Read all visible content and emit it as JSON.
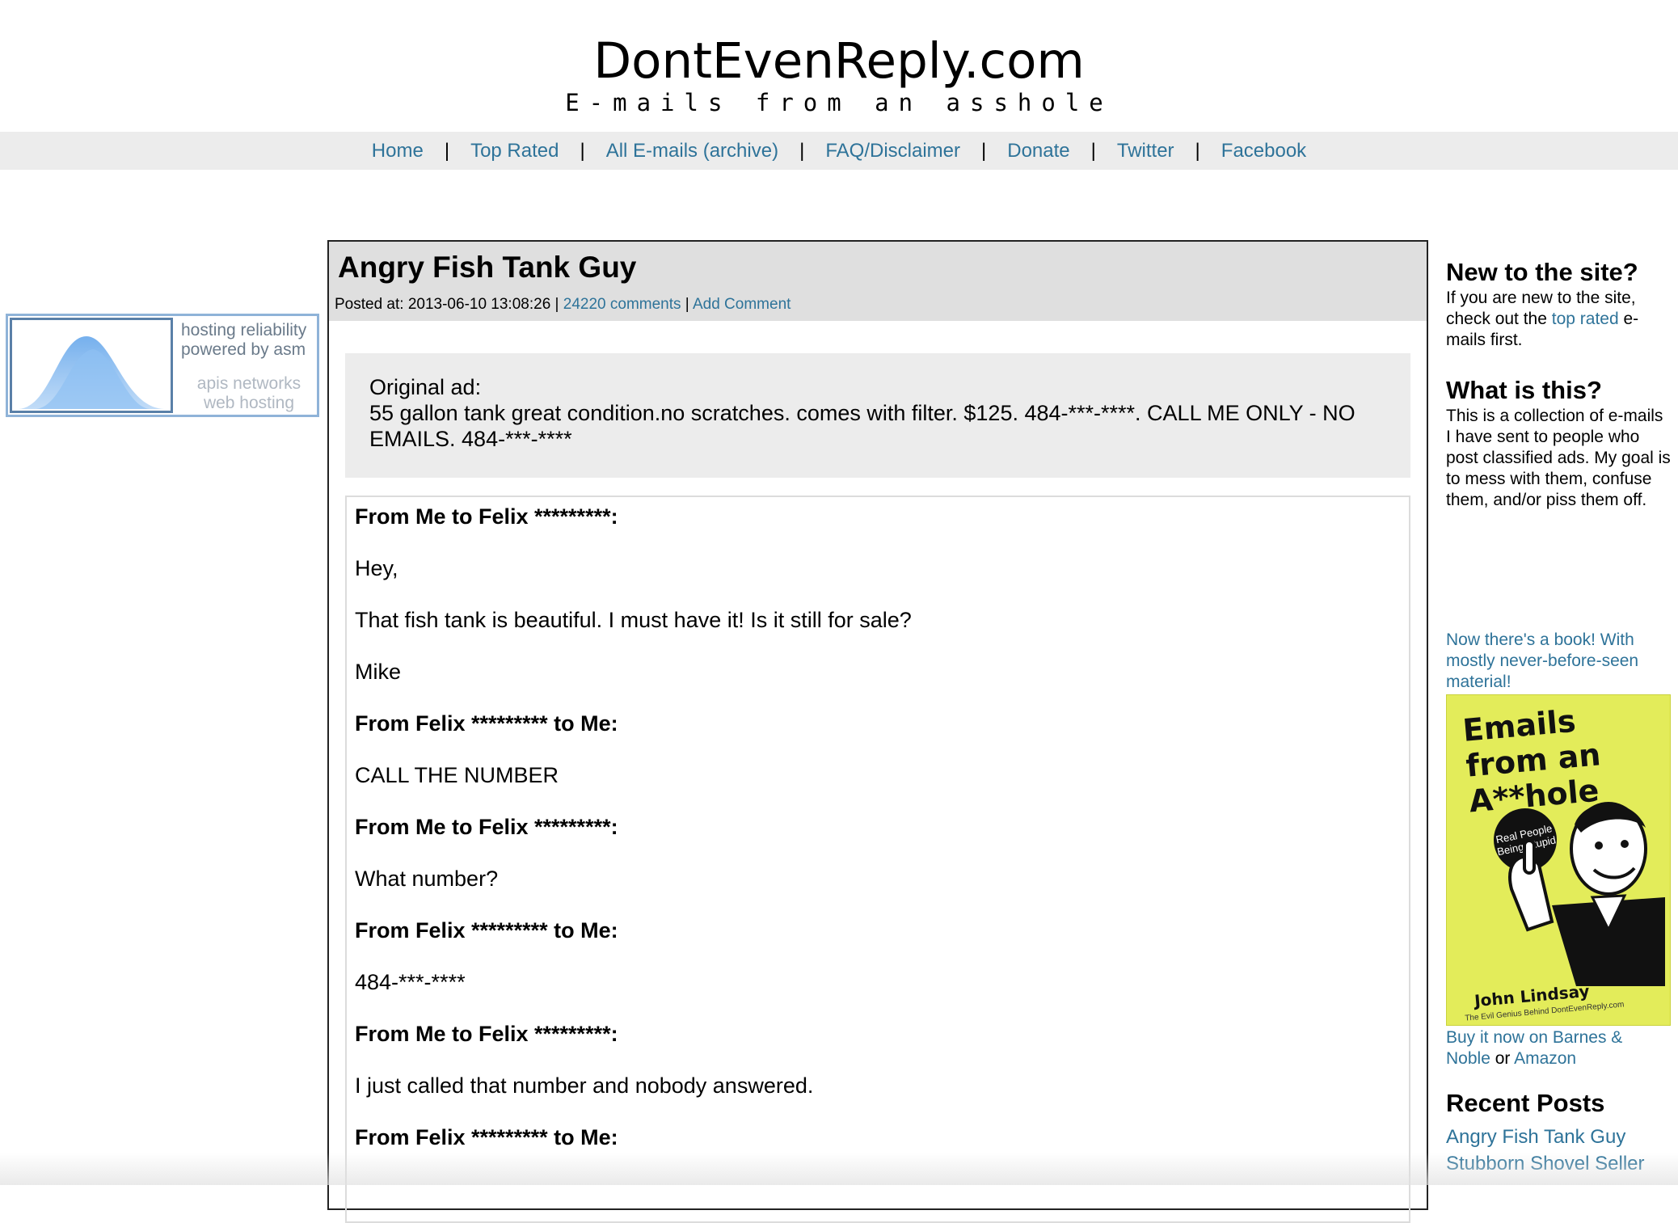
{
  "site": {
    "title": "DontEvenReply.com",
    "tagline": "E-mails from an asshole"
  },
  "nav": {
    "items": [
      "Home",
      "Top Rated",
      "All E-mails (archive)",
      "FAQ/Disclaimer",
      "Donate",
      "Twitter",
      "Facebook"
    ],
    "separator": "|"
  },
  "ad": {
    "line1": "hosting reliability",
    "line2": "powered by asm",
    "line3": "apis networks",
    "line4": "web hosting"
  },
  "post": {
    "title": "Angry Fish Tank Guy",
    "posted_label": "Posted at: 2013-06-10 13:08:26 |",
    "comments_link": "24220 comments",
    "meta_sep": "|",
    "add_comment_link": "Add Comment",
    "original_ad_label": "Original ad:",
    "original_ad_text": "55 gallon tank great condition.no scratches. comes with filter. $125. 484-***-****. CALL ME ONLY - NO EMAILS. 484-***-****",
    "emails": [
      {
        "type": "header",
        "text": "From Me to Felix *********:"
      },
      {
        "type": "body",
        "text": "Hey,"
      },
      {
        "type": "body",
        "text": "That fish tank is beautiful. I must have it! Is it still for sale?"
      },
      {
        "type": "body",
        "text": "Mike"
      },
      {
        "type": "header",
        "text": "From Felix ********* to Me:"
      },
      {
        "type": "body",
        "text": "CALL THE NUMBER"
      },
      {
        "type": "header",
        "text": "From Me to Felix *********:"
      },
      {
        "type": "body",
        "text": "What number?"
      },
      {
        "type": "header",
        "text": "From Felix ********* to Me:"
      },
      {
        "type": "body",
        "text": "484-***-****"
      },
      {
        "type": "header",
        "text": "From Me to Felix *********:"
      },
      {
        "type": "body",
        "text": "I just called that number and nobody answered."
      },
      {
        "type": "header",
        "text": "From Felix ********* to Me:"
      }
    ]
  },
  "sidebar": {
    "new_heading": "New to the site?",
    "new_text_1": "If you are new to the site, check out the ",
    "new_link": "top rated",
    "new_text_2": " e-mails first.",
    "what_heading": "What is this?",
    "what_text": "This is a collection of e-mails I have sent to people who post classified ads. My goal is to mess with them, confuse them, and/or piss them off.",
    "book_promo": "Now there's a book! With mostly never-before-seen material!",
    "book_cover": {
      "title": "Emails from an A**hole",
      "badge": "Real People Being Stupid",
      "author": "John Lindsay",
      "credit": "The Evil Genius Behind DontEvenReply.com"
    },
    "buy_link_1": "Buy it now on Barnes & Noble",
    "buy_or": " or ",
    "buy_link_2": "Amazon",
    "recent_heading": "Recent Posts",
    "recent_posts": [
      "Angry Fish Tank Guy",
      "Stubborn Shovel Seller"
    ]
  },
  "colors": {
    "link": "#2e7399",
    "nav_bg": "#ececec",
    "post_head_bg": "#dfdfdf",
    "book_cover_bg": "#e3ec5a"
  }
}
